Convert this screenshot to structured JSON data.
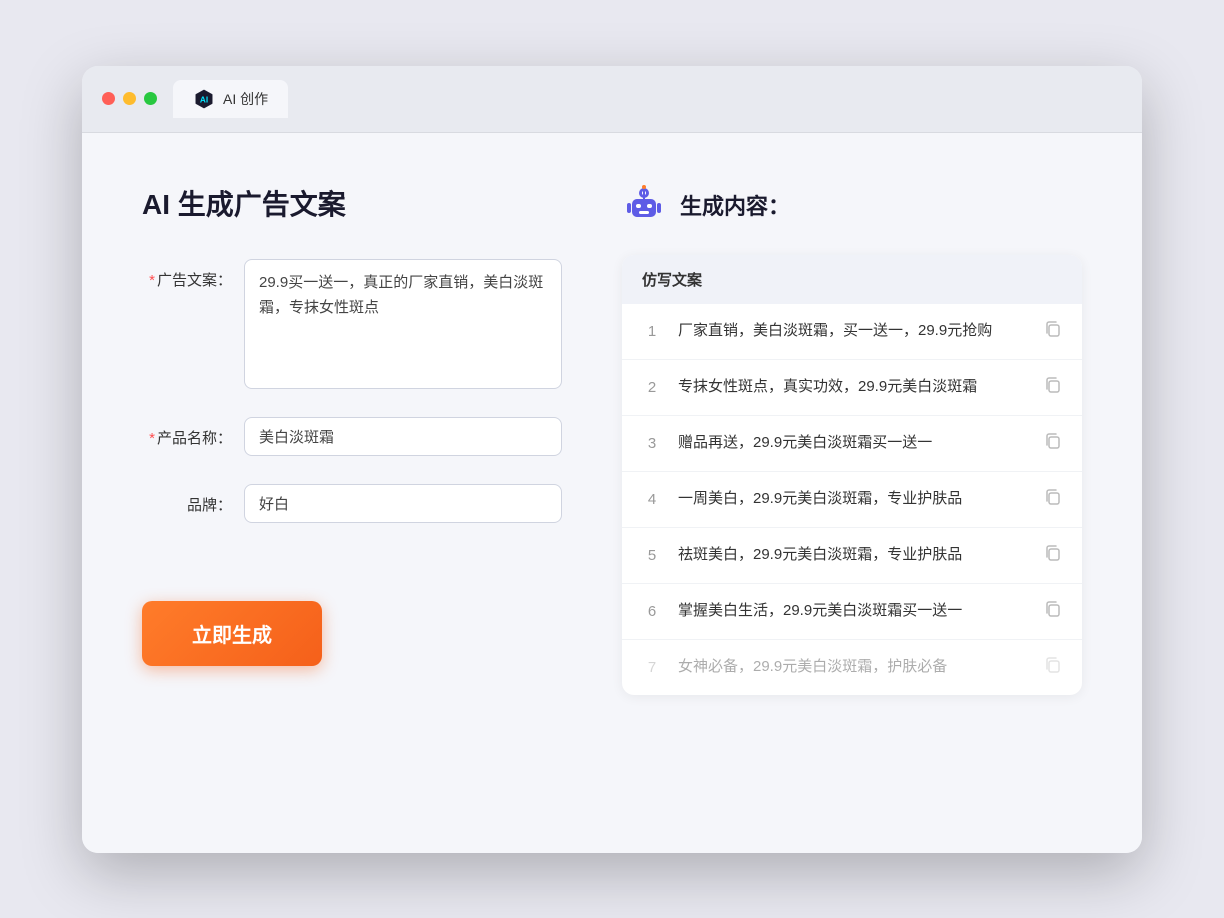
{
  "browser": {
    "tab_label": "AI 创作"
  },
  "page": {
    "title": "AI 生成广告文案",
    "result_title": "生成内容："
  },
  "form": {
    "ad_copy_label": "广告文案：",
    "ad_copy_required": true,
    "ad_copy_value": "29.9买一送一，真正的厂家直销，美白淡斑霜，专抹女性斑点",
    "product_name_label": "产品名称：",
    "product_name_required": true,
    "product_name_value": "美白淡斑霜",
    "brand_label": "品牌：",
    "brand_required": false,
    "brand_value": "好白",
    "generate_button": "立即生成"
  },
  "results": {
    "column_header": "仿写文案",
    "items": [
      {
        "id": 1,
        "text": "厂家直销，美白淡斑霜，买一送一，29.9元抢购",
        "faded": false
      },
      {
        "id": 2,
        "text": "专抹女性斑点，真实功效，29.9元美白淡斑霜",
        "faded": false
      },
      {
        "id": 3,
        "text": "赠品再送，29.9元美白淡斑霜买一送一",
        "faded": false
      },
      {
        "id": 4,
        "text": "一周美白，29.9元美白淡斑霜，专业护肤品",
        "faded": false
      },
      {
        "id": 5,
        "text": "祛斑美白，29.9元美白淡斑霜，专业护肤品",
        "faded": false
      },
      {
        "id": 6,
        "text": "掌握美白生活，29.9元美白淡斑霜买一送一",
        "faded": false
      },
      {
        "id": 7,
        "text": "女神必备，29.9元美白淡斑霜，护肤必备",
        "faded": true
      }
    ]
  }
}
